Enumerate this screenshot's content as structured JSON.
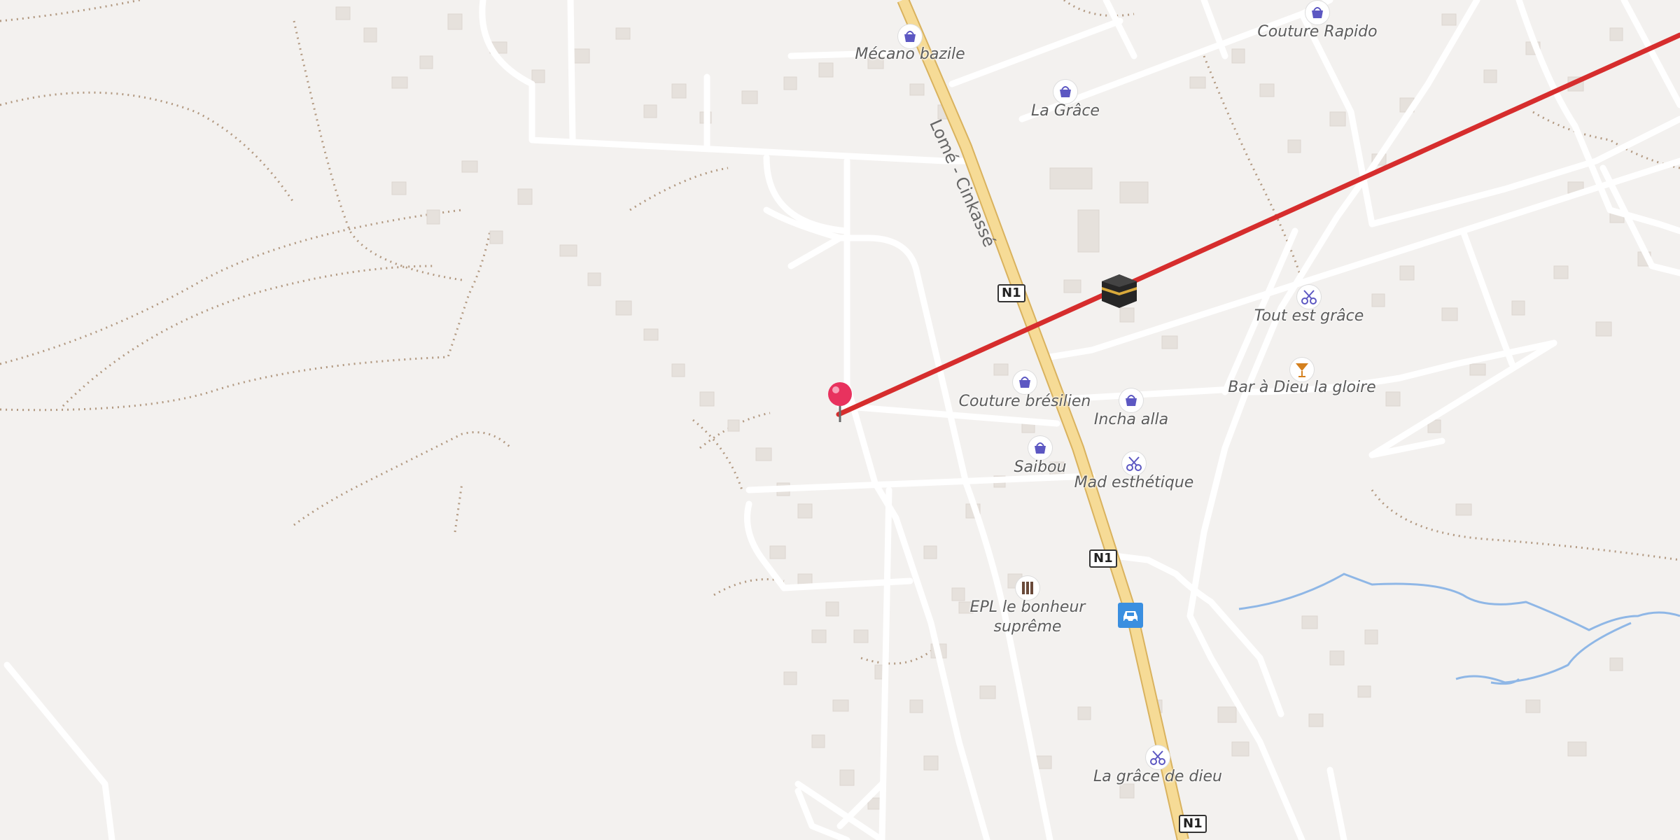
{
  "map": {
    "colors": {
      "background": "#f3f1ef",
      "road": "#ffffff",
      "primary_road": "#f6db96",
      "route": "#d62d2d",
      "water": "#8fb7e6",
      "building": "#e6e1dc",
      "path": "#b39a82",
      "poi_icon": "#5c57c2"
    },
    "road_name": "Lomé - Cinkassé",
    "route_ref": "N1",
    "pois": [
      {
        "name": "Mécano bazile",
        "icon": "shopping-basket-icon"
      },
      {
        "name": "Couture Rapido",
        "icon": "shopping-basket-icon"
      },
      {
        "name": "La Grâce",
        "icon": "shopping-basket-icon"
      },
      {
        "name": "Tout est grâce",
        "icon": "scissors-icon"
      },
      {
        "name": "Bar à Dieu la gloire",
        "icon": "cocktail-icon"
      },
      {
        "name": "Couture brésilien",
        "icon": "shopping-basket-icon"
      },
      {
        "name": "Incha alla",
        "icon": "shopping-basket-icon"
      },
      {
        "name": "Saibou",
        "icon": "shopping-basket-icon"
      },
      {
        "name": "Mad esthétique",
        "icon": "scissors-icon"
      },
      {
        "name": "EPL le bonheur suprême",
        "icon": "school-icon"
      },
      {
        "name": "La grâce de dieu",
        "icon": "scissors-icon"
      }
    ],
    "markers": [
      {
        "name": "location-pin-icon"
      },
      {
        "name": "mosque-kaaba-icon"
      },
      {
        "name": "car-icon"
      }
    ]
  }
}
